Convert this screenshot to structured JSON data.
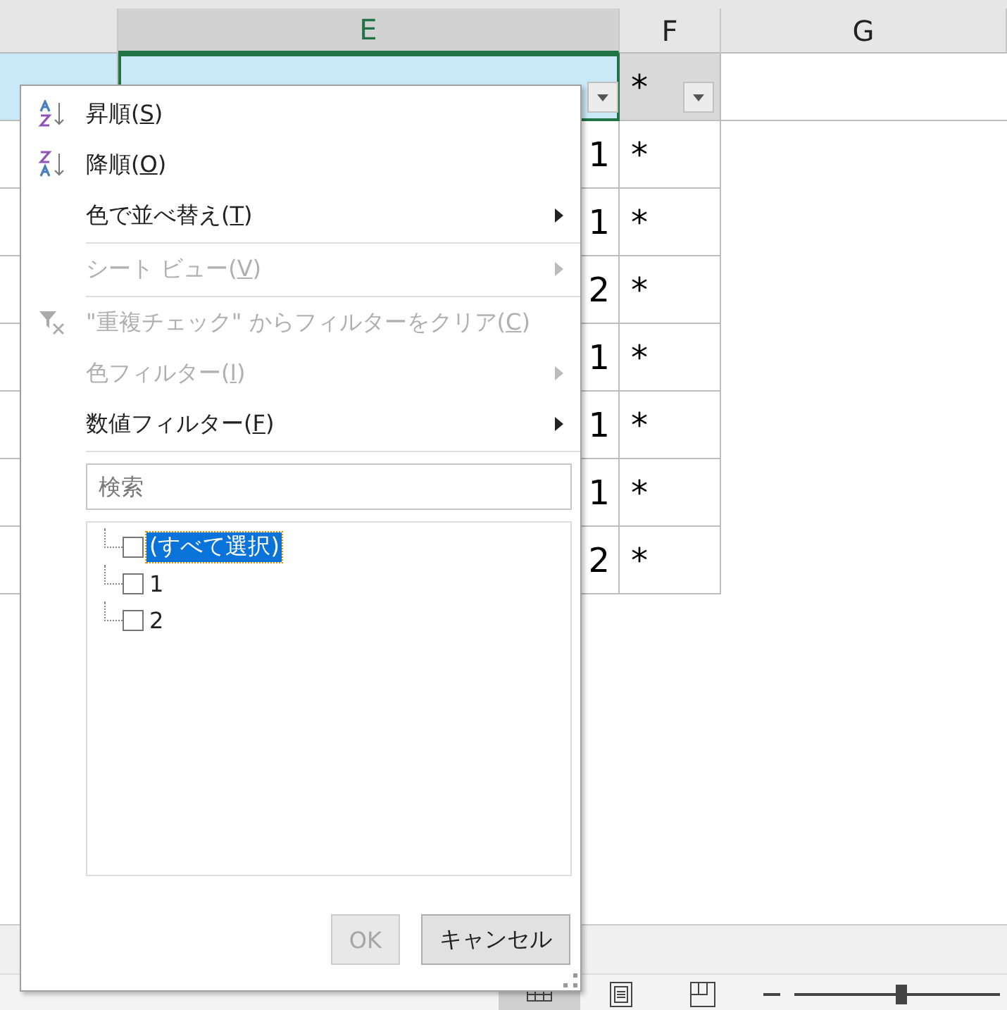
{
  "columns": [
    {
      "label": "E",
      "selected": true
    },
    {
      "label": "F",
      "selected": false
    },
    {
      "label": "G",
      "selected": false
    }
  ],
  "header_row": {
    "f": "*"
  },
  "rows": [
    {
      "e": "1",
      "f": "*"
    },
    {
      "e": "1",
      "f": "*"
    },
    {
      "e": "2",
      "f": "*"
    },
    {
      "e": "1",
      "f": "*"
    },
    {
      "e": "1",
      "f": "*"
    },
    {
      "e": "1",
      "f": "*"
    },
    {
      "e": "2",
      "f": "*"
    }
  ],
  "menu": {
    "items": [
      {
        "kind": "sort_asc",
        "label": "昇順(",
        "accel": "S",
        "tail": ")",
        "disabled": false,
        "submenu": false,
        "separator_after": false
      },
      {
        "kind": "sort_desc",
        "label": "降順(",
        "accel": "O",
        "tail": ")",
        "disabled": false,
        "submenu": false,
        "separator_after": false
      },
      {
        "kind": "item",
        "label": "色で並べ替え(",
        "accel": "T",
        "tail": ")",
        "disabled": false,
        "submenu": true,
        "separator_after": true
      },
      {
        "kind": "item",
        "label": "シート ビュー(",
        "accel": "V",
        "tail": ")",
        "disabled": true,
        "submenu": true,
        "separator_after": true
      },
      {
        "kind": "clear_filter",
        "label": "\"重複チェック\" からフィルターをクリア(",
        "accel": "C",
        "tail": ")",
        "disabled": true,
        "submenu": false,
        "separator_after": false
      },
      {
        "kind": "item",
        "label": "色フィルター(",
        "accel": "I",
        "tail": ")",
        "disabled": true,
        "submenu": true,
        "separator_after": false
      },
      {
        "kind": "item",
        "label": "数値フィルター(",
        "accel": "F",
        "tail": ")",
        "disabled": false,
        "submenu": true,
        "separator_after": true
      }
    ],
    "search": {
      "placeholder": "検索"
    },
    "values": [
      {
        "label": "(すべて選択)",
        "checked": false,
        "selected": true
      },
      {
        "label": "1",
        "checked": false,
        "selected": false
      },
      {
        "label": "2",
        "checked": false,
        "selected": false
      }
    ],
    "buttons": [
      {
        "label": "OK",
        "disabled": true
      },
      {
        "label": "キャンセル",
        "disabled": false
      }
    ]
  },
  "status_bar": {
    "views": [
      {
        "kind": "normal",
        "selected": true
      },
      {
        "kind": "page_layout",
        "selected": false
      },
      {
        "kind": "page_break",
        "selected": false
      }
    ],
    "zoom": {
      "level": 0.52
    }
  }
}
